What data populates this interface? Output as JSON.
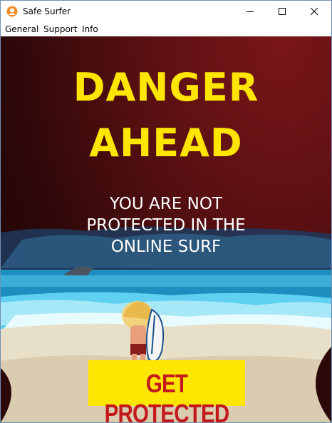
{
  "window": {
    "title": "Safe Surfer"
  },
  "menu": {
    "items": [
      "General",
      "Support",
      "Info"
    ]
  },
  "hero": {
    "heading_line1": "DANGER",
    "heading_line2": "AHEAD",
    "sub_line1": "YOU ARE NOT",
    "sub_line2": "PROTECTED IN THE",
    "sub_line3": "ONLINE SURF"
  },
  "cta": {
    "label": "GET PROTECTED"
  },
  "colors": {
    "heading": "#ffe600",
    "cta_bg": "#ffe600",
    "cta_text": "#c4191b",
    "bg": "#5a1012"
  }
}
